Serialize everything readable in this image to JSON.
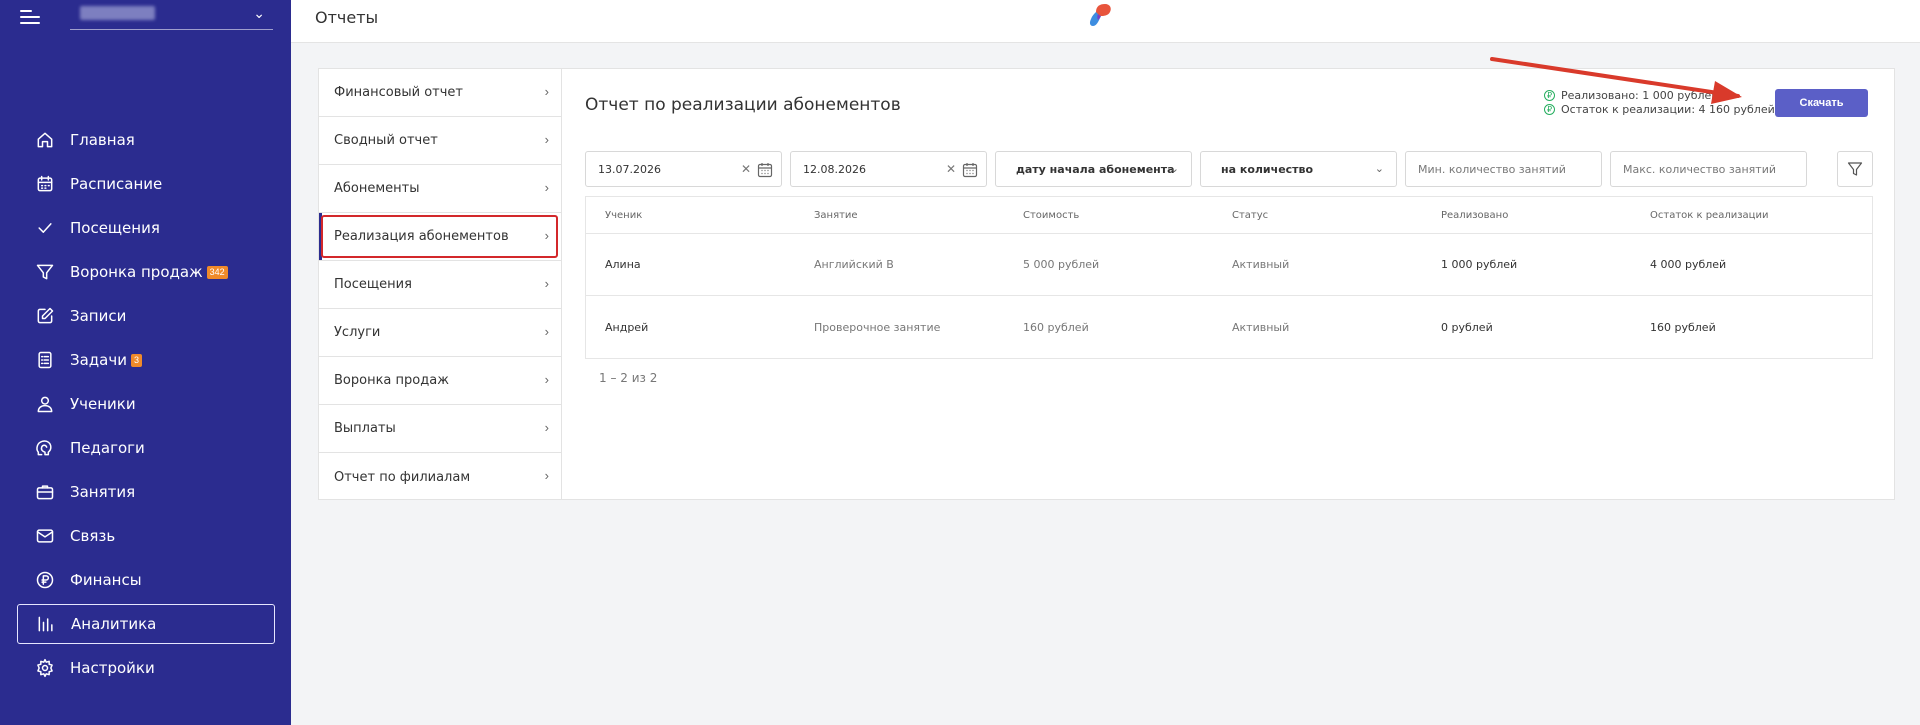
{
  "sidebar": {
    "items": [
      {
        "label": "Главная",
        "icon": "home-icon"
      },
      {
        "label": "Расписание",
        "icon": "calendar-icon"
      },
      {
        "label": "Посещения",
        "icon": "check-icon"
      },
      {
        "label": "Воронка продаж",
        "icon": "funnel-icon",
        "badge": "342"
      },
      {
        "label": "Записи",
        "icon": "edit-icon"
      },
      {
        "label": "Задачи",
        "icon": "tasks-icon",
        "badge": "3"
      },
      {
        "label": "Ученики",
        "icon": "user-icon"
      },
      {
        "label": "Педагоги",
        "icon": "teacher-icon"
      },
      {
        "label": "Занятия",
        "icon": "briefcase-icon"
      },
      {
        "label": "Связь",
        "icon": "mail-icon"
      },
      {
        "label": "Финансы",
        "icon": "ruble-icon"
      },
      {
        "label": "Аналитика",
        "icon": "analytics-icon",
        "active": true
      },
      {
        "label": "Настройки",
        "icon": "settings-icon"
      }
    ],
    "badge_color": "#f08a2a",
    "background": "#2b2c8f"
  },
  "header": {
    "title": "Отчеты"
  },
  "report_menu": {
    "items": [
      {
        "label": "Финансовый отчет"
      },
      {
        "label": "Сводный отчет"
      },
      {
        "label": "Абонементы"
      },
      {
        "label": "Реализация абонементов",
        "selected": true
      },
      {
        "label": "Посещения"
      },
      {
        "label": "Услуги"
      },
      {
        "label": "Воронка продаж"
      },
      {
        "label": "Выплаты"
      },
      {
        "label": "Отчет по филиалам"
      }
    ]
  },
  "panel": {
    "title": "Отчет по реализации абонементов",
    "summary": {
      "realized": "Реализовано: 1 000 рублей",
      "remaining": "Остаток к реализации: 4 160 рублей"
    },
    "download_label": "Скачать",
    "filters": {
      "date_from": "13.07.2026",
      "date_to": "12.08.2026",
      "date_type": "дату начала абонемента",
      "count_type": "на количество",
      "min_placeholder": "Мин. количество занятий",
      "max_placeholder": "Макс. количество занятий"
    },
    "table": {
      "columns": [
        "Ученик",
        "Занятие",
        "Стоимость",
        "Статус",
        "Реализовано",
        "Остаток к реализации"
      ],
      "rows": [
        [
          "Алина",
          "Английский В",
          "5 000 рублей",
          "Активный",
          "1 000 рублей",
          "4 000 рублей"
        ],
        [
          "Андрей",
          "Проверочное занятие",
          "160 рублей",
          "Активный",
          "0 рублей",
          "160 рублей"
        ]
      ]
    },
    "pagination": "1 – 2 из 2"
  },
  "colors": {
    "accent": "#5b5fc7",
    "highlight": "#d3282b",
    "success": "#27ae60"
  }
}
